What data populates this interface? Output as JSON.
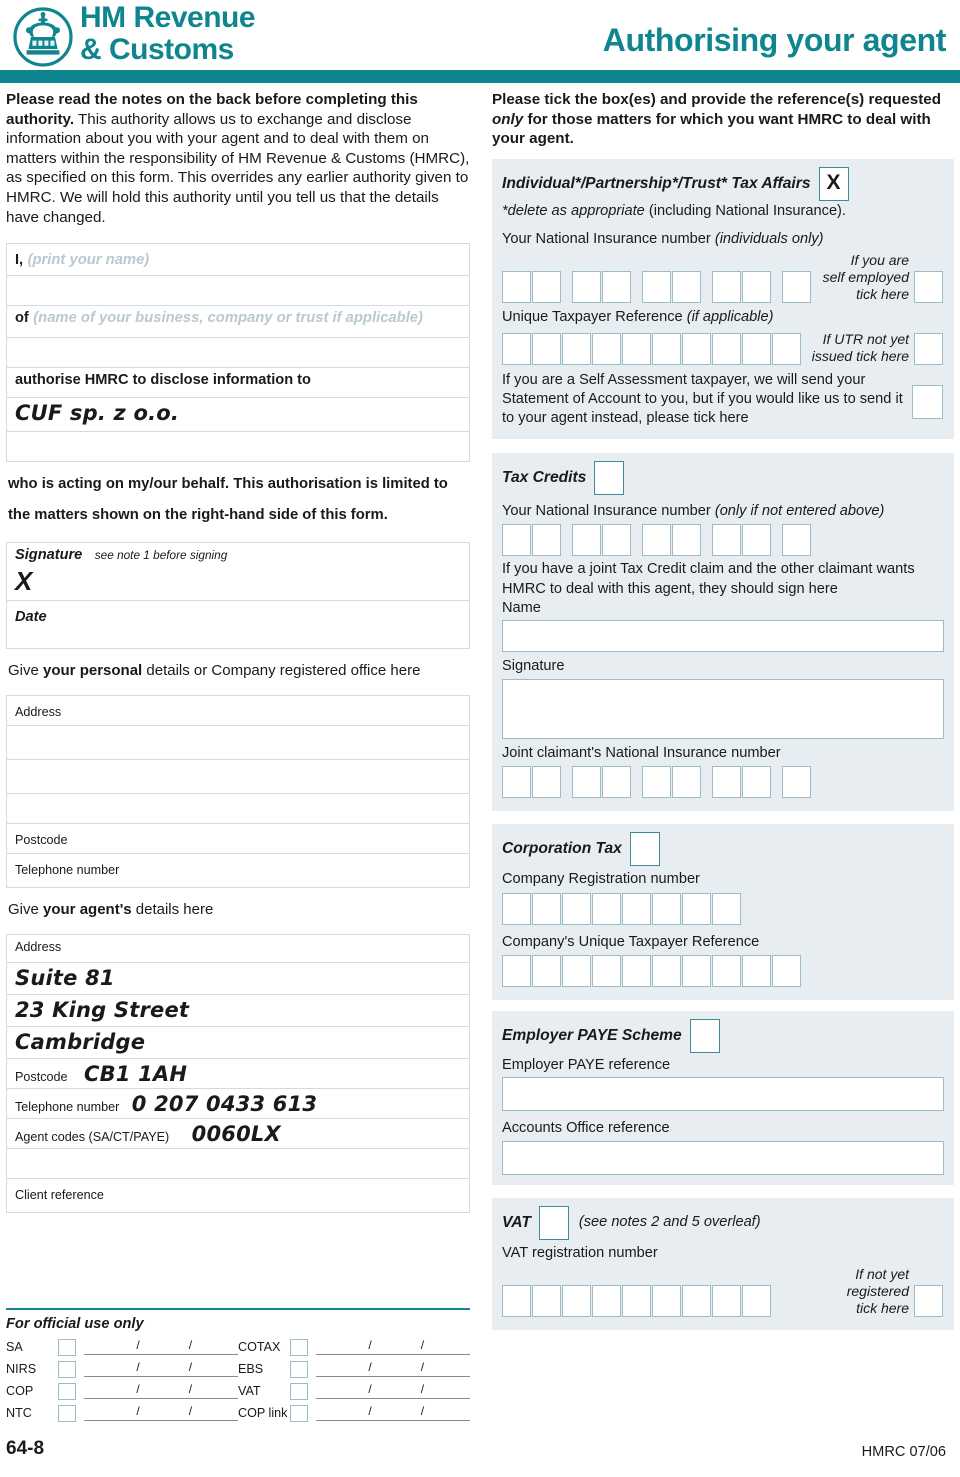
{
  "header": {
    "logo_line1": "HM Revenue",
    "logo_line2": "& Customs",
    "crown_icon": "crown-icon",
    "title": "Authorising your agent"
  },
  "colors": {
    "teal": "#0E858F",
    "panel_bg": "#E7EDF0",
    "box_border": "#9dbcc6",
    "tick_border": "#3c8d99"
  },
  "left": {
    "intro_bold": "Please read the notes on the back before completing this authority.",
    "intro_rest": " This authority allows us to exchange and disclose information about you with your agent and to deal with them on matters within the responsibility of HM Revenue & Customs (HMRC), as specified on this form. This overrides any earlier authority given to HMRC. We will hold this authority until you tell us that the details have changed.",
    "i_label": "I,",
    "i_placeholder": "(print your name)",
    "i_value": "",
    "i_value_line2": "",
    "of_label": "of",
    "of_placeholder": "(name of your business, company or trust if applicable)",
    "of_value": "",
    "authorise_label": "authorise HMRC to disclose information to",
    "agent_name_value": "CUF sp. z o.o.",
    "agent_name_value_line2": "",
    "behalf_line1": "who is acting on my/our behalf. This authorisation is limited to",
    "behalf_line2": "the matters shown on the right-hand side of this form.",
    "signature_label": "Signature",
    "signature_note": "see note 1 before signing",
    "signature_value": "X",
    "date_label": "Date",
    "date_value": "",
    "personal_head_a": "Give ",
    "personal_head_b": "your personal",
    "personal_head_c": " details or Company registered office here",
    "personal": {
      "address_label": "Address",
      "address_line1": "",
      "address_line2": "",
      "address_line3": "",
      "address_line4": "",
      "postcode_label": "Postcode",
      "postcode_value": "",
      "telephone_label": "Telephone number",
      "telephone_value": ""
    },
    "agent_head_a": "Give ",
    "agent_head_b": "your agent's",
    "agent_head_c": " details here",
    "agent": {
      "address_label": "Address",
      "address_line1": "Suite 81",
      "address_line2": "23 King Street",
      "address_line3": "Cambridge",
      "postcode_label": "Postcode",
      "postcode_value": "CB1 1AH",
      "telephone_label": "Telephone number",
      "telephone_value": "0 207 0433 613",
      "agent_codes_label": "Agent codes (SA/CT/PAYE)",
      "agent_codes_value": "0060LX",
      "agent_codes_value_line2": "",
      "client_ref_label": "Client reference",
      "client_ref_value": ""
    }
  },
  "right": {
    "intro_bold_a": "Please tick the box(es) and provide the reference(s) requested ",
    "intro_italic": "only",
    "intro_bold_b": " for those matters for which you want HMRC to deal with your agent.",
    "individual": {
      "title": "Individual*/Partnership*/Trust* Tax Affairs",
      "tick_value": "X",
      "delete_note_italic": "*delete as appropriate",
      "delete_note_rest": " (including National Insurance).",
      "ni_label": "Your National Insurance number",
      "ni_label_italic": "(individuals only)",
      "ni_groups": [
        2,
        2,
        2,
        2,
        1
      ],
      "self_employed_note_l1": "If you are",
      "self_employed_note_l2": "self employed",
      "self_employed_note_l3": "tick here",
      "self_employed_tick": "",
      "utr_label": "Unique Taxpayer Reference",
      "utr_label_italic": "(if applicable)",
      "utr_boxes": 10,
      "utr_note_l1": "If UTR not yet",
      "utr_note_l2": "issued tick here",
      "utr_tick": "",
      "soa_text": "If you are a Self Assessment taxpayer, we will send your Statement of Account to you, but if you would like us to send it to your agent instead, please tick here",
      "soa_tick": ""
    },
    "tax_credits": {
      "title": "Tax Credits",
      "tick_value": "",
      "ni_label": "Your National Insurance number",
      "ni_label_italic": "(only if not entered above)",
      "ni_groups": [
        2,
        2,
        2,
        2,
        1
      ],
      "joint_text": "If you have a joint Tax Credit claim and the other claimant wants HMRC to deal with this agent, they should sign here",
      "name_label": "Name",
      "name_value": "",
      "signature_label": "Signature",
      "signature_value": "",
      "joint_ni_label": "Joint claimant's National Insurance number",
      "joint_ni_groups": [
        2,
        2,
        2,
        2,
        1
      ]
    },
    "corporation_tax": {
      "title": "Corporation Tax",
      "tick_value": "",
      "crn_label": "Company Registration number",
      "crn_boxes": 8,
      "cutr_label": "Company's Unique Taxpayer Reference",
      "cutr_boxes": 10
    },
    "employer_paye": {
      "title": "Employer PAYE Scheme",
      "tick_value": "",
      "paye_ref_label": "Employer PAYE reference",
      "paye_ref_value": "",
      "accounts_office_label": "Accounts Office reference",
      "accounts_office_value": ""
    },
    "vat": {
      "title": "VAT",
      "tick_value": "",
      "note": "(see notes 2 and 5 overleaf)",
      "reg_label": "VAT registration number",
      "reg_boxes": 9,
      "not_registered_l1": "If not yet",
      "not_registered_l2": "registered",
      "not_registered_l3": "tick here",
      "not_registered_tick": ""
    }
  },
  "official_use": {
    "title": "For official use only",
    "left_rows": [
      "SA",
      "NIRS",
      "COP",
      "NTC"
    ],
    "right_rows": [
      "COTAX",
      "EBS",
      "VAT",
      "COP link"
    ],
    "separator": "/"
  },
  "footer": {
    "form_number": "64-8",
    "reference": "HMRC 07/06"
  }
}
